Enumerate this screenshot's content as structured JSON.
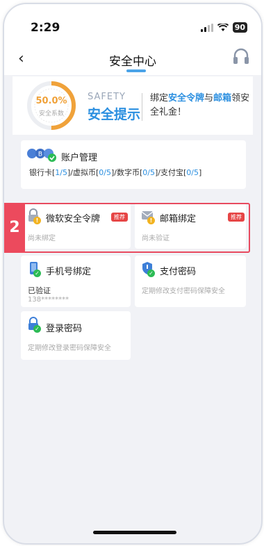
{
  "status_bar": {
    "time": "2:29",
    "battery": "90"
  },
  "nav": {
    "title": "安全中心"
  },
  "safety": {
    "percent_label": "50.0%",
    "percent_sub": "安全系数",
    "score_fraction": 0.5,
    "label_en": "SAFETY",
    "label_cn": "安全提示",
    "promo_prefix": "绑定",
    "promo_hl1": "安全令牌",
    "promo_mid": "与",
    "promo_hl2": "邮箱",
    "promo_suffix": "领安全礼金！"
  },
  "account": {
    "title": "账户管理",
    "items": [
      {
        "name": "银行卡",
        "value": "1/5"
      },
      {
        "name": "虚拟币",
        "value": "0/5"
      },
      {
        "name": "数字币",
        "value": "0/5"
      },
      {
        "name": "支付宝",
        "value": "0/5"
      }
    ]
  },
  "cards": {
    "token": {
      "title": "微软安全令牌",
      "tag": "推荐",
      "status": "尚未绑定"
    },
    "email": {
      "title": "邮箱绑定",
      "tag": "推荐",
      "status": "尚未验证"
    },
    "phone": {
      "title": "手机号绑定",
      "status": "已验证",
      "detail": "138********"
    },
    "paypwd": {
      "title": "支付密码",
      "status": "定期修改支付密码保障安全"
    },
    "loginpwd": {
      "title": "登录密码",
      "status": "定期修改登录密码保障安全"
    }
  },
  "overlay": {
    "number": "2"
  },
  "colors": {
    "accent": "#2b8fe0",
    "warning": "#f2b320",
    "ok": "#2cbb55",
    "highlight": "#ec4a5d",
    "gauge": "#f0a23a"
  }
}
